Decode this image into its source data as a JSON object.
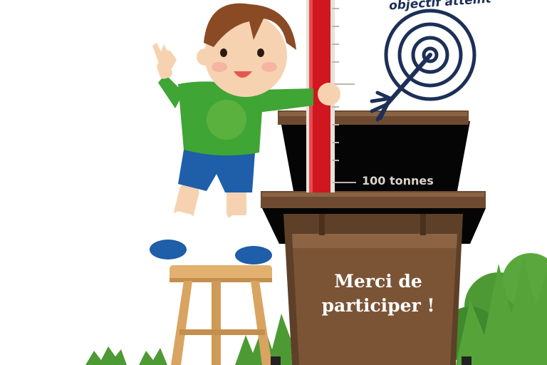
{
  "goal": {
    "label": "objectif atteint"
  },
  "gauge": {
    "marker_label": "100 tonnes"
  },
  "bin": {
    "message_line1": "Merci de",
    "message_line2": "participer !"
  },
  "colors": {
    "gauge_red": "#d0161e",
    "bin_brown": "#7b5436",
    "bin_lid": "#5e3f27",
    "bush_green": "#4d9a35",
    "shirt_green": "#3fa535",
    "shorts_blue": "#1f5ea8",
    "target_navy": "#1c2f57"
  },
  "icons": [
    "target-icon",
    "arrow-icon"
  ]
}
